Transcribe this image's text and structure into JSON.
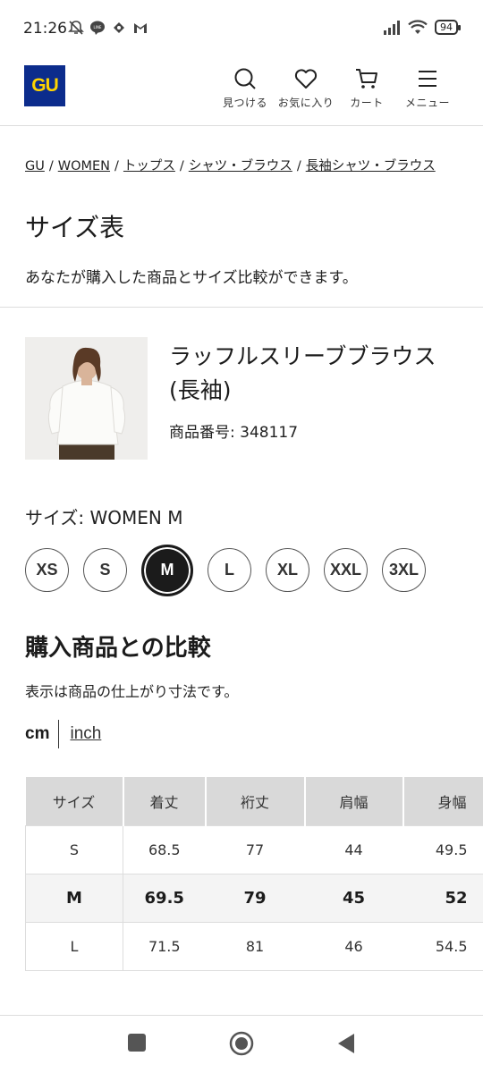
{
  "status": {
    "time": "21:26",
    "battery": "94"
  },
  "header": {
    "logo": "GU",
    "nav": [
      {
        "label": "見つける",
        "icon": "search-icon"
      },
      {
        "label": "お気に入り",
        "icon": "heart-icon"
      },
      {
        "label": "カート",
        "icon": "cart-icon"
      },
      {
        "label": "メニュー",
        "icon": "menu-icon"
      }
    ]
  },
  "breadcrumb": [
    "GU",
    "WOMEN",
    "トップス",
    "シャツ・ブラウス",
    "長袖シャツ・ブラウス"
  ],
  "page": {
    "title": "サイズ表",
    "description": "あなたが購入した商品とサイズ比較ができます。"
  },
  "product": {
    "name": "ラッフルスリーブブラウス(長袖)",
    "number": "商品番号: 348117"
  },
  "size_select": {
    "label": "サイズ: WOMEN M",
    "options": [
      "XS",
      "S",
      "M",
      "L",
      "XL",
      "XXL",
      "3XL"
    ],
    "selected": "M"
  },
  "compare": {
    "title": "購入商品との比較",
    "note": "表示は商品の仕上がり寸法です。",
    "unit_cm": "cm",
    "unit_inch": "inch"
  },
  "table": {
    "headers": [
      "サイズ",
      "着丈",
      "裄丈",
      "肩幅",
      "身幅"
    ],
    "rows": [
      {
        "size": "S",
        "values": [
          "68.5",
          "77",
          "44",
          "49.5"
        ]
      },
      {
        "size": "M",
        "values": [
          "69.5",
          "79",
          "45",
          "52"
        ]
      },
      {
        "size": "L",
        "values": [
          "71.5",
          "81",
          "46",
          "54.5"
        ]
      }
    ]
  },
  "colors": {
    "logo_bg": "#0c2c8c",
    "logo_text": "#ffd400",
    "header_row_bg": "#d9d9d9",
    "highlight_row_bg": "#f4f4f4"
  }
}
